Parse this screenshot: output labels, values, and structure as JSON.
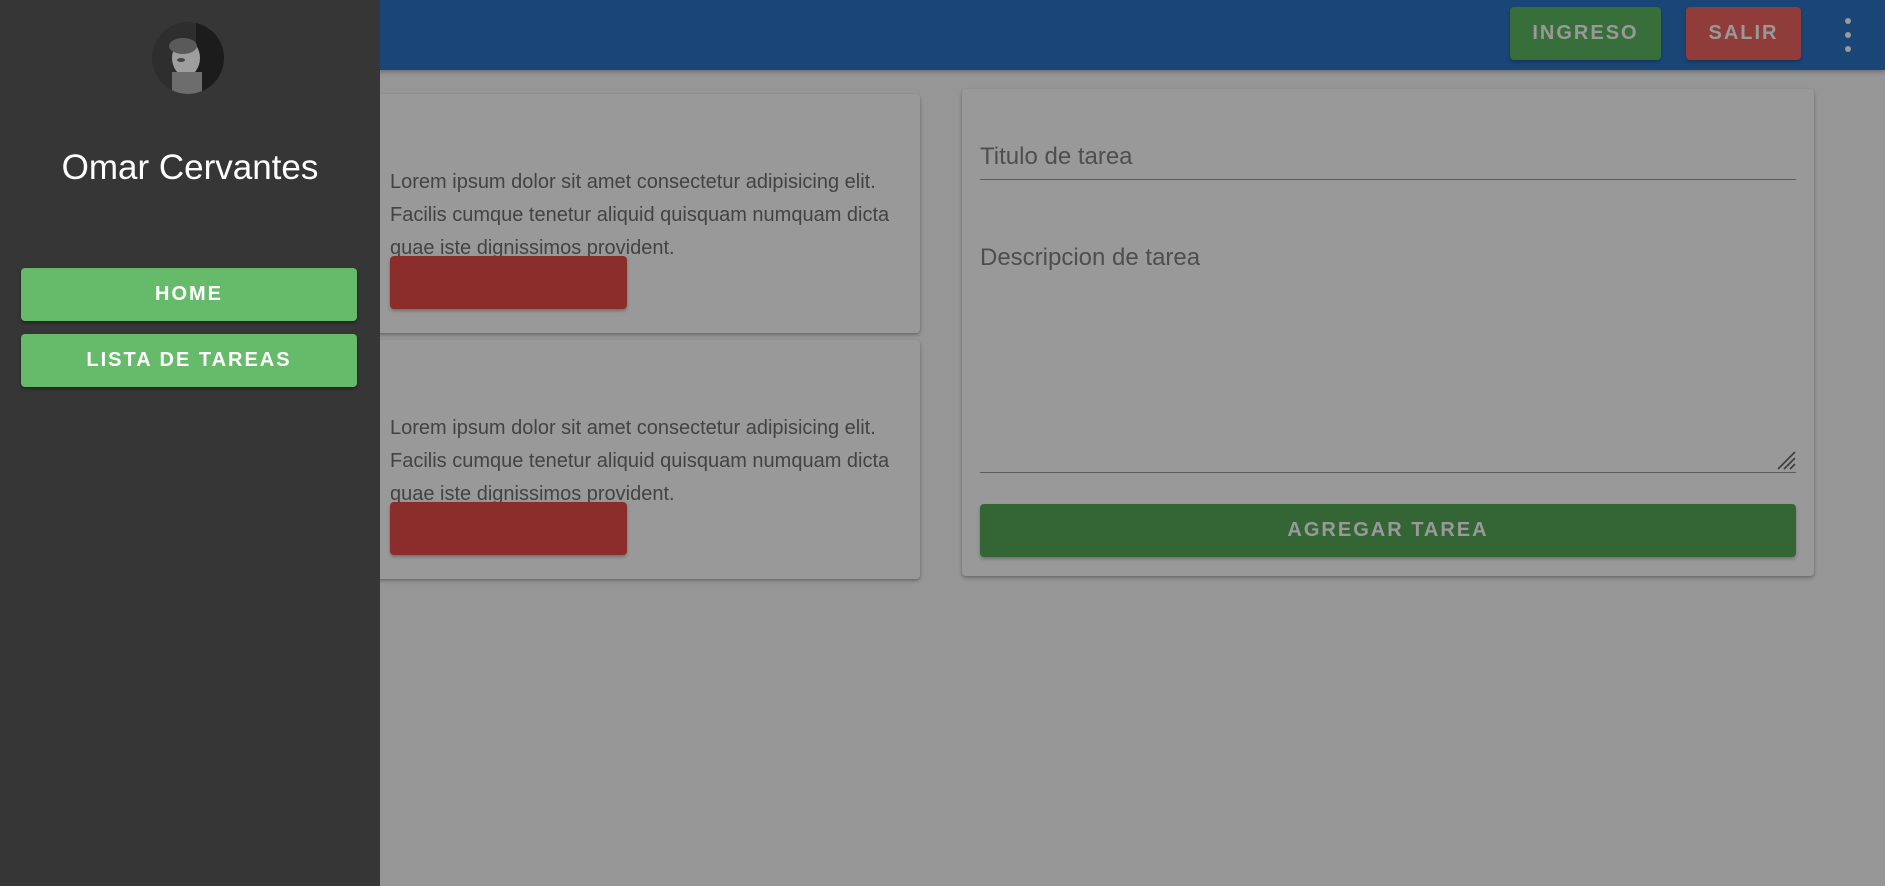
{
  "toolbar": {
    "ingreso_label": "INGRESO",
    "salir_label": "SALIR",
    "menu_icon": "more-vert-icon"
  },
  "cards": [
    {
      "title": "",
      "text": "Lorem ipsum dolor sit amet consectetur adipisicing elit. Facilis cumque tenetur aliquid quisquam numquam dicta quae iste dignissimos provident.",
      "button_label": ""
    },
    {
      "title": "",
      "text": "Lorem ipsum dolor sit amet consectetur adipisicing elit. Facilis cumque tenetur aliquid quisquam numquam dicta quae iste dignissimos provident.",
      "button_label": ""
    }
  ],
  "form": {
    "title_placeholder": "Titulo de tarea",
    "description_placeholder": "Descripcion de tarea",
    "submit_label": "AGREGAR TAREA"
  },
  "drawer": {
    "user_name": "Omar Cervantes",
    "nav": [
      {
        "label": "HOME"
      },
      {
        "label": "LISTA DE TAREAS"
      }
    ]
  },
  "colors": {
    "toolbar": "#1565c0",
    "ingreso": "#4caf50",
    "salir": "#ef5350",
    "drawer": "#363636",
    "nav_button": "#66bb6a",
    "agregar": "#43a047",
    "card_button": "#e53935"
  }
}
